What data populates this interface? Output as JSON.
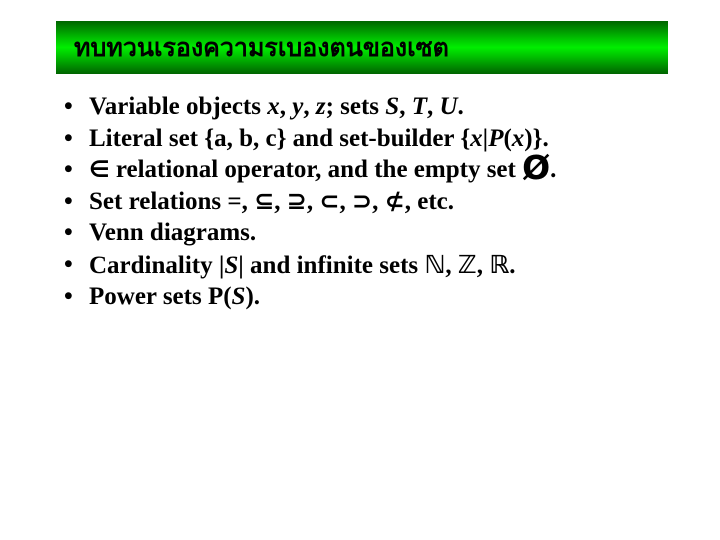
{
  "slide": {
    "title": "ทบทวนเรองความรเบองตนของเซต",
    "title_bar_gradient": {
      "edge_color": "#006400",
      "center_color": "#00ee00"
    },
    "background_color": "#ffffff",
    "text_color": "#000000",
    "bullets": [
      {
        "id": "variable-objects",
        "segments": [
          {
            "t": "Variable objects ",
            "style": "plain"
          },
          {
            "t": "x",
            "style": "italic"
          },
          {
            "t": ", ",
            "style": "plain"
          },
          {
            "t": "y",
            "style": "italic"
          },
          {
            "t": ", ",
            "style": "plain"
          },
          {
            "t": "z",
            "style": "italic"
          },
          {
            "t": "; sets ",
            "style": "plain"
          },
          {
            "t": "S",
            "style": "italic"
          },
          {
            "t": ", ",
            "style": "plain"
          },
          {
            "t": "T",
            "style": "italic"
          },
          {
            "t": ", ",
            "style": "plain"
          },
          {
            "t": "U",
            "style": "italic"
          },
          {
            "t": ".",
            "style": "plain"
          }
        ],
        "plain_text": "Variable objects x, y, z; sets S, T, U."
      },
      {
        "id": "literal-and-set-builder",
        "segments": [
          {
            "t": "Literal set {a, b, c} and set-builder {",
            "style": "plain"
          },
          {
            "t": "x",
            "style": "italic"
          },
          {
            "t": "|",
            "style": "plain"
          },
          {
            "t": "P",
            "style": "italic"
          },
          {
            "t": "(",
            "style": "plain"
          },
          {
            "t": "x",
            "style": "italic"
          },
          {
            "t": ")}.",
            "style": "plain"
          }
        ],
        "plain_text": "Literal set {a, b, c} and set-builder {x|P(x)}."
      },
      {
        "id": "membership-and-empty-set",
        "segments": [
          {
            "t": "∈",
            "style": "opsym"
          },
          {
            "t": " relational operator, and the empty set ",
            "style": "plain"
          },
          {
            "t": "Ø",
            "style": "bigsym"
          },
          {
            "t": ".",
            "style": "plain"
          }
        ],
        "plain_text": "∈ relational operator, and the empty set Ø."
      },
      {
        "id": "set-relations",
        "segments": [
          {
            "t": "Set relations =, ",
            "style": "plain"
          },
          {
            "t": "⊆",
            "style": "relsym"
          },
          {
            "t": ", ",
            "style": "plain"
          },
          {
            "t": "⊇",
            "style": "relsym"
          },
          {
            "t": ", ",
            "style": "plain"
          },
          {
            "t": "⊂",
            "style": "relsym"
          },
          {
            "t": ", ",
            "style": "plain"
          },
          {
            "t": "⊃",
            "style": "relsym"
          },
          {
            "t": ", ",
            "style": "plain"
          },
          {
            "t": "⊄",
            "style": "relsym"
          },
          {
            "t": ", etc.",
            "style": "plain"
          }
        ],
        "plain_text": "Set relations =, ⊆, ⊇, ⊂, ⊃, ⊄, etc."
      },
      {
        "id": "venn-diagrams",
        "segments": [
          {
            "t": "Venn diagrams.",
            "style": "plain"
          }
        ],
        "plain_text": "Venn diagrams."
      },
      {
        "id": "cardinality-and-infinite-sets",
        "segments": [
          {
            "t": "Cardinality |",
            "style": "plain"
          },
          {
            "t": "S",
            "style": "italic"
          },
          {
            "t": "| and infinite sets ",
            "style": "plain"
          },
          {
            "t": "ℕ",
            "style": "bb"
          },
          {
            "t": ", ",
            "style": "plain"
          },
          {
            "t": "ℤ",
            "style": "bb"
          },
          {
            "t": ", ",
            "style": "plain"
          },
          {
            "t": "ℝ",
            "style": "bb"
          },
          {
            "t": ".",
            "style": "plain"
          }
        ],
        "plain_text": "Cardinality |S| and infinite sets ℕ, ℤ, ℝ."
      },
      {
        "id": "power-sets",
        "segments": [
          {
            "t": "Power sets P(",
            "style": "plain"
          },
          {
            "t": "S",
            "style": "italic"
          },
          {
            "t": ").",
            "style": "plain"
          }
        ],
        "plain_text": "Power sets P(S)."
      }
    ]
  }
}
